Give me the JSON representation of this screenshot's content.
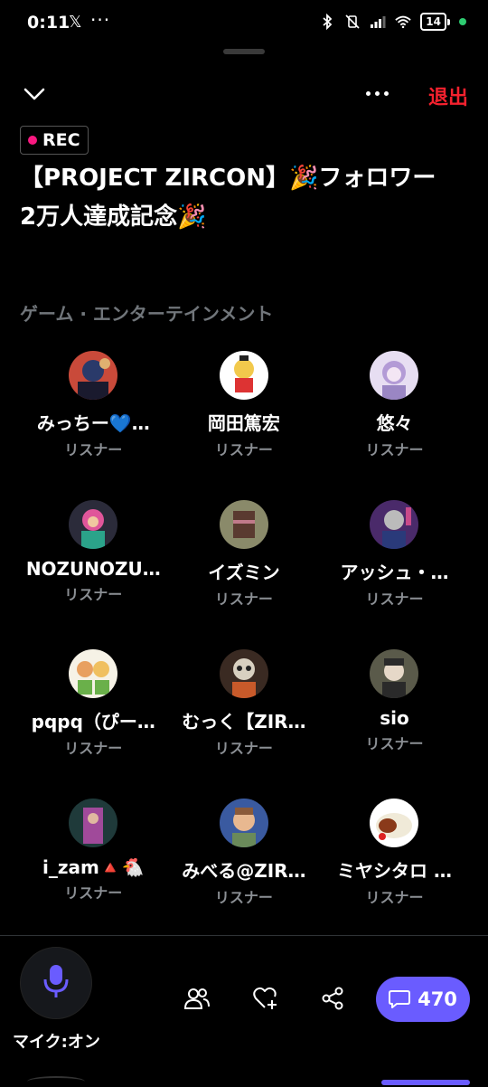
{
  "status_bar": {
    "time": "0:11",
    "battery": "14"
  },
  "header": {
    "exit_label": "退出"
  },
  "rec_badge": {
    "label": "REC"
  },
  "title": "【PROJECT ZIRCON】🎉フォロワー2万人達成記念🎉",
  "section_label": "ゲーム · エンターテインメント",
  "participants": [
    {
      "name": "みっちー💙…",
      "role": "リスナー"
    },
    {
      "name": "岡田篤宏",
      "role": "リスナー"
    },
    {
      "name": "悠々",
      "role": "リスナー"
    },
    {
      "name": "NOZUNOZU…",
      "role": "リスナー"
    },
    {
      "name": "イズミン",
      "role": "リスナー"
    },
    {
      "name": "アッシュ・…",
      "role": "リスナー"
    },
    {
      "name": "pqpq（ぴー…",
      "role": "リスナー"
    },
    {
      "name": "むっく【ZIR…",
      "role": "リスナー"
    },
    {
      "name": "sio",
      "role": "リスナー"
    },
    {
      "name": "i_zam🔺🐔",
      "role": "リスナー"
    },
    {
      "name": "みべる@ZIR…",
      "role": "リスナー"
    },
    {
      "name": "ミヤシタロ …",
      "role": "リスナー"
    }
  ],
  "mic": {
    "label": "マイク:オン"
  },
  "chat": {
    "count": "470"
  },
  "colors": {
    "accent": "#6a5cff",
    "exit": "#f4212e",
    "rec": "#f91880"
  }
}
